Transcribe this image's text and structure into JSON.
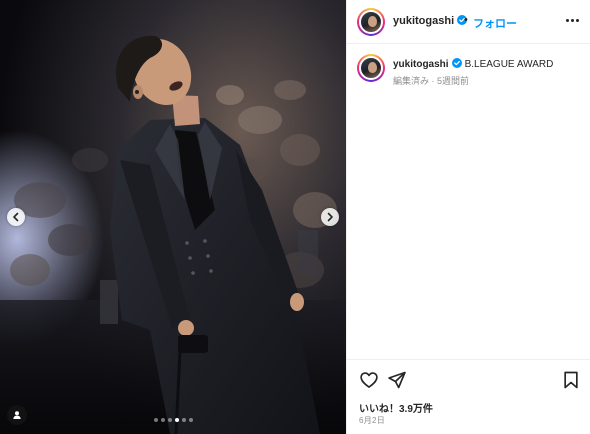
{
  "post": {
    "username": "yukitogashi",
    "separator": "•",
    "follow_label": "フォロー",
    "caption_username": "yukitogashi",
    "caption_text": "B.LEAGUE AWARD",
    "caption_meta": "編集済み · 5週間前",
    "likes_text": "いいね！3.9万件",
    "date_text": "6月2日",
    "carousel": {
      "total": 6,
      "active_index": 3
    }
  },
  "icons": {
    "verified": "verified-badge-icon",
    "more": "more-options-icon",
    "like": "heart-icon",
    "share": "paper-plane-icon",
    "save": "bookmark-icon",
    "prev": "chevron-left-icon",
    "next": "chevron-right-icon",
    "tags": "user-tag-icon"
  },
  "colors": {
    "link_blue": "#0095f6",
    "verified_blue": "#0095f6",
    "text": "#262626",
    "muted": "#8e8e8e",
    "divider": "#efefef"
  }
}
